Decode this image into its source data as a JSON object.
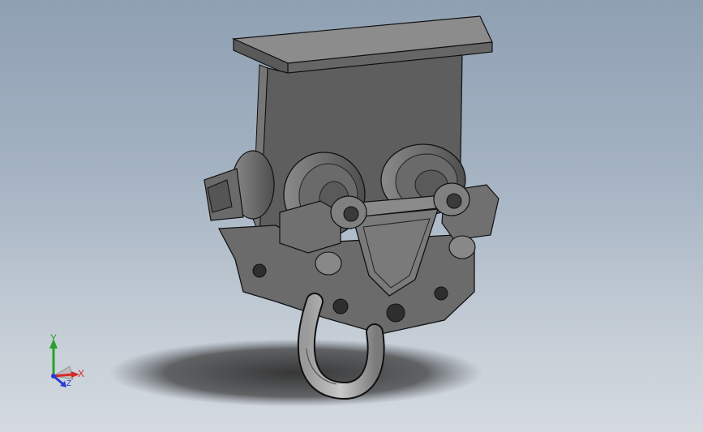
{
  "viewport": {
    "model": "beam-trolley-with-hook",
    "colors": {
      "background_top": "#8fa0b3",
      "background_bottom": "#d4dae0",
      "part_face": "#6b6b6b",
      "part_light": "#8a8a8a",
      "part_dark": "#4a4a4a",
      "edge": "#111111",
      "shadow": "#3a3a3a"
    }
  },
  "triad": {
    "x_label": "X",
    "y_label": "Y",
    "z_label": "Z",
    "colors": {
      "x": "#d42a2a",
      "y": "#2aa02a",
      "z": "#2a3ad4"
    }
  }
}
